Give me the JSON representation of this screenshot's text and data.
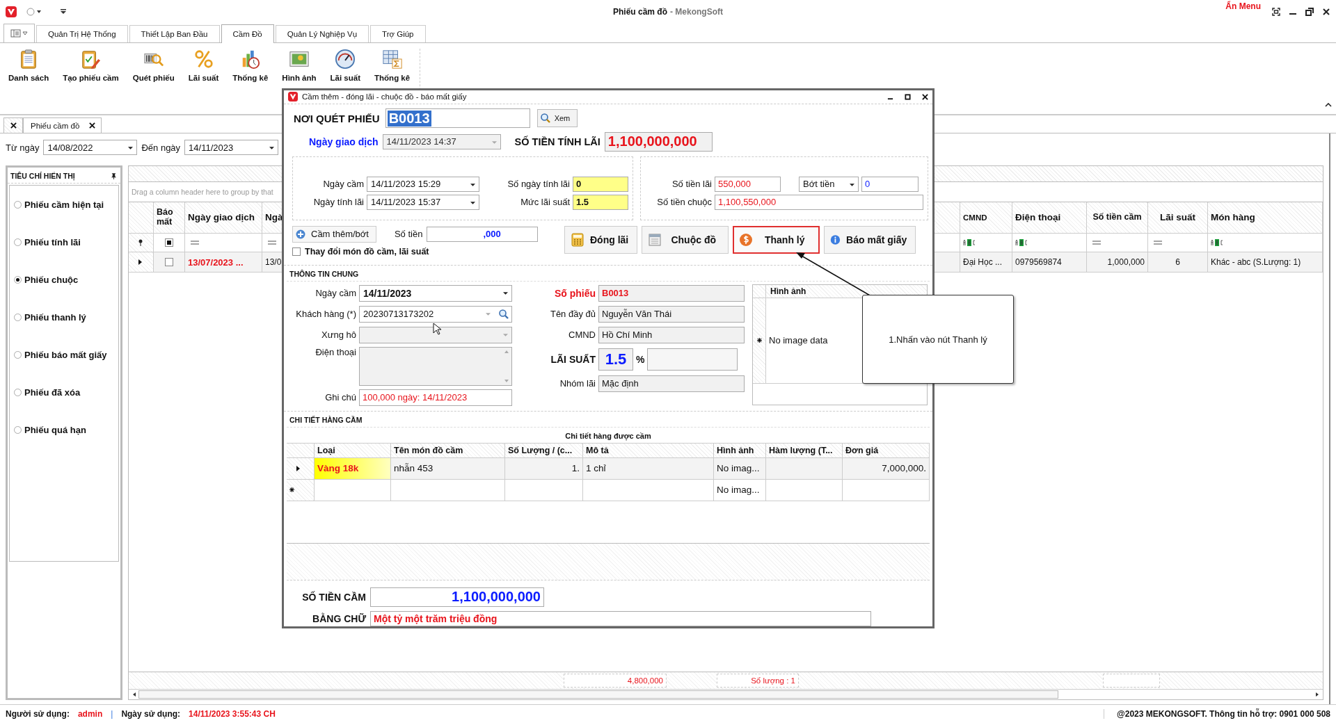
{
  "window": {
    "title": "Phiếu cầm đồ",
    "app_name": "- MekongSoft",
    "hide_menu": "Ẩn Menu"
  },
  "ribbon_tabs": [
    {
      "label": "Quản Trị Hệ Thống",
      "selected": false
    },
    {
      "label": "Thiết Lập Ban Đầu",
      "selected": false
    },
    {
      "label": "Cầm Đồ",
      "selected": true
    },
    {
      "label": "Quản Lý Nghiệp Vụ",
      "selected": false
    },
    {
      "label": "Trợ Giúp",
      "selected": false
    }
  ],
  "ribbon_buttons": [
    {
      "label": "Danh sách",
      "kind": "list"
    },
    {
      "label": "Tạo phiếu cầm",
      "kind": "create"
    },
    {
      "label": "Quét phiếu",
      "kind": "scan"
    },
    {
      "label": "Lãi suất",
      "kind": "percent"
    },
    {
      "label": "Thống kê",
      "kind": "stats"
    },
    {
      "label": "Hình ảnh",
      "kind": "picture"
    },
    {
      "label": "Lãi suất",
      "kind": "gauge"
    },
    {
      "label": "Thống kê",
      "kind": "sheet"
    }
  ],
  "doc_tabs": [
    {
      "label": "Phiếu cầm đồ",
      "selected": true
    }
  ],
  "filter": {
    "from_label": "Từ ngày",
    "from": "14/08/2022",
    "to_label": "Đến ngày",
    "to": "14/11/2023"
  },
  "criteria": {
    "title": "TIÊU CHÍ HIỂN THỊ",
    "options": [
      {
        "label": "Phiếu cầm hiện tại",
        "selected": false
      },
      {
        "label": "Phiếu tính lãi",
        "selected": false
      },
      {
        "label": "Phiếu chuộc",
        "selected": true
      },
      {
        "label": "Phiếu thanh lý",
        "selected": false
      },
      {
        "label": "Phiếu báo mất giấy",
        "selected": false
      },
      {
        "label": "Phiếu đã xóa",
        "selected": false
      },
      {
        "label": "Phiếu quá hạn",
        "selected": false
      }
    ]
  },
  "grid": {
    "group_hint": "Drag a column header here to group by that",
    "lost_column": {
      "label": "Báo mất",
      "kind": "check"
    },
    "columns": [
      {
        "label": "Ngày giao dịch",
        "kind": "eq"
      },
      {
        "label": "Ngà",
        "kind": "eq"
      },
      {
        "label": "CMND",
        "kind": "abc"
      },
      {
        "label": "Điện thoại",
        "kind": "abc"
      },
      {
        "label": "Số tiền cầm",
        "kind": "eq"
      },
      {
        "label": "Lãi suất",
        "kind": "eq"
      },
      {
        "label": "Món hàng",
        "kind": "abc"
      }
    ],
    "rows": [
      {
        "lost": false,
        "cells": [
          "13/07/2023 ...",
          "13/0",
          "Đại Học ...",
          "0979569874",
          "1,000,000",
          "6",
          "Khác - abc (S.Lượng: 1)"
        ]
      }
    ],
    "summary": [
      "4,800,000",
      "Số lượng : 1"
    ]
  },
  "status": {
    "user_label": "Người sử dụng:",
    "user": "admin",
    "separator": "|",
    "date_label": "Ngày sử dụng:",
    "date": "14/11/2023 3:55:43 CH",
    "support": "@2023 MEKONGSOFT. Thông tin hỗ trợ: 0901 000 508"
  },
  "dialog": {
    "title": "Cầm thêm - đóng lãi - chuộc đồ - báo mất giấy",
    "scan": {
      "label": "NƠI QUÉT PHIẾU",
      "value": "B0013",
      "button": "Xem"
    },
    "trans_date": {
      "label": "Ngày giao dịch",
      "value": "14/11/2023 14:37"
    },
    "interest_base": {
      "label": "SỐ TIỀN TÍNH LÃI",
      "value": "1,100,000,000"
    },
    "dates": [
      {
        "label": "Ngày cầm",
        "value": "14/11/2023 15:29",
        "kind": "combo"
      },
      {
        "label": "Số ngày tính lãi",
        "value": "0",
        "kind": "highlight"
      },
      {
        "label": "Ngày tính lãi",
        "value": "14/11/2023 15:37",
        "kind": "combo"
      },
      {
        "label": "Mức lãi suất",
        "value": "1.5",
        "kind": "highlight"
      }
    ],
    "interest": {
      "label": "Số tiền lãi",
      "value": "550,000"
    },
    "discount": {
      "option": "Bớt tiền",
      "value": "0"
    },
    "redeem": {
      "label": "Số tiền chuộc",
      "value": "1,100,550,000"
    },
    "add_button": "Cầm thêm/bớt",
    "amount": {
      "label": "Số tiền",
      "value": ",000"
    },
    "change_check": {
      "label": "Thay đổi món đồ cầm, lãi suất",
      "checked": false
    },
    "actions": [
      {
        "label": "Đóng lãi",
        "kind": "calc",
        "selected": false
      },
      {
        "label": "Chuộc đồ",
        "kind": "doc",
        "selected": false
      },
      {
        "label": "Thanh lý",
        "kind": "coin",
        "selected": true
      },
      {
        "label": "Báo mất giấy",
        "kind": "info",
        "selected": false
      }
    ],
    "general": {
      "title": "THÔNG TIN CHUNG",
      "left": [
        {
          "label": "Ngày cầm",
          "value": "14/11/2023",
          "kind": "combo"
        },
        {
          "label": "Khách hàng (*)",
          "value": "20230713173202",
          "kind": "search"
        },
        {
          "label": "Xưng hô",
          "kind": "combo"
        },
        {
          "label": "Điện thoại",
          "kind": "memo"
        },
        {
          "label": "Ghi chú",
          "value": "100,000 ngày: 14/11/2023",
          "kind": "note"
        }
      ],
      "right": [
        {
          "label": "Số phiếu",
          "value": "B0013",
          "kind": "alert"
        },
        {
          "label": "Tên đầy đủ",
          "value": "Nguyễn Văn Thái",
          "kind": "text"
        },
        {
          "label": "CMND",
          "value": "Hồ Chí Minh",
          "kind": "text"
        },
        {
          "label": "LÃI SUẤT",
          "value": "1.5",
          "unit": "%",
          "kind": "rate"
        },
        {
          "label": "Nhóm lãi",
          "value": "Mặc định",
          "kind": "text"
        }
      ],
      "image_column": "Hình ảnh",
      "image_empty": "No image data"
    },
    "items": {
      "title": "CHI TIẾT HÀNG CẦM",
      "caption": "Chi tiết hàng được cầm",
      "columns": [
        "Loại",
        "Tên món đồ cầm",
        "Số Lượng / (c...",
        "Mô tả",
        "Hình ảnh",
        "Hàm lượng (T...",
        "Đơn giá"
      ],
      "rows": [
        {
          "type": "Vàng 18k",
          "name": "nhẫn 453",
          "qty": "1.",
          "desc": "1 chỉ",
          "image": "No imag...",
          "price": "7,000,000."
        }
      ],
      "new_row_image": "No imag..."
    },
    "total": {
      "label": "SỐ TIỀN CẦM",
      "value": "1,100,000,000"
    },
    "words": {
      "label": "BẰNG CHỮ",
      "value": "Một tỷ một trăm triệu đồng"
    }
  },
  "callout": "1.Nhấn vào nút Thanh lý"
}
